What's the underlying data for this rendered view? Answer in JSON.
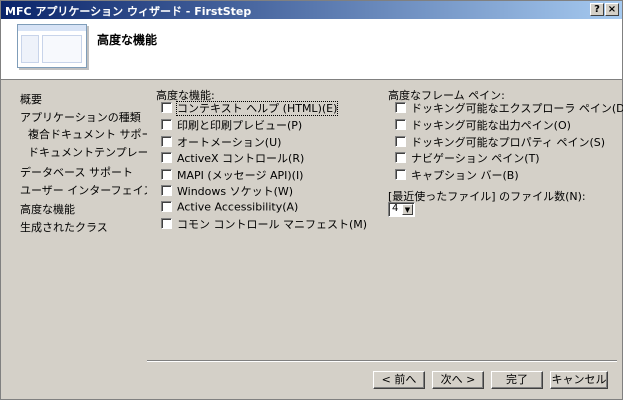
{
  "window": {
    "title": "MFC アプリケーション ウィザード - FirstStep",
    "help_button": "?",
    "close_button": "×"
  },
  "header": {
    "title": "高度な機能"
  },
  "nav": {
    "items": [
      {
        "label": "概要"
      },
      {
        "label": "アプリケーションの種類"
      },
      {
        "label": "複合ドキュメント サポート"
      },
      {
        "label": "ドキュメントテンプレート文字列"
      },
      {
        "label": "データベース サポート"
      },
      {
        "label": "ユーザー インターフェイス機能"
      },
      {
        "label": "高度な機能"
      },
      {
        "label": "生成されたクラス"
      }
    ]
  },
  "features": {
    "title": "高度な機能:",
    "options": [
      {
        "label": "コンテキスト ヘルプ (HTML)(E)",
        "checked": false
      },
      {
        "label": "印刷と印刷プレビュー(P)",
        "checked": false
      },
      {
        "label": "オートメーション(U)",
        "checked": false
      },
      {
        "label": "ActiveX コントロール(R)",
        "checked": false
      },
      {
        "label": "MAPI (メッセージ API)(I)",
        "checked": false
      },
      {
        "label": "Windows ソケット(W)",
        "checked": false
      },
      {
        "label": "Active Accessibility(A)",
        "checked": false
      },
      {
        "label": "コモン コントロール マニフェスト(M)",
        "checked": false
      }
    ]
  },
  "frame_panes": {
    "title": "高度なフレーム ペイン:",
    "options": [
      {
        "label": "ドッキング可能なエクスプローラ ペイン(D)",
        "checked": false
      },
      {
        "label": "ドッキング可能な出力ペイン(O)",
        "checked": false
      },
      {
        "label": "ドッキング可能なプロパティ ペイン(S)",
        "checked": false
      },
      {
        "label": "ナビゲーション ペイン(T)",
        "checked": false
      },
      {
        "label": "キャプション バー(B)",
        "checked": false
      }
    ]
  },
  "recent_files": {
    "label": "[最近使ったファイル] のファイル数(N):",
    "value": "4",
    "arrow": "▼"
  },
  "buttons": {
    "back": "< 前へ",
    "next": "次へ >",
    "finish": "完了",
    "cancel": "キャンセル"
  }
}
